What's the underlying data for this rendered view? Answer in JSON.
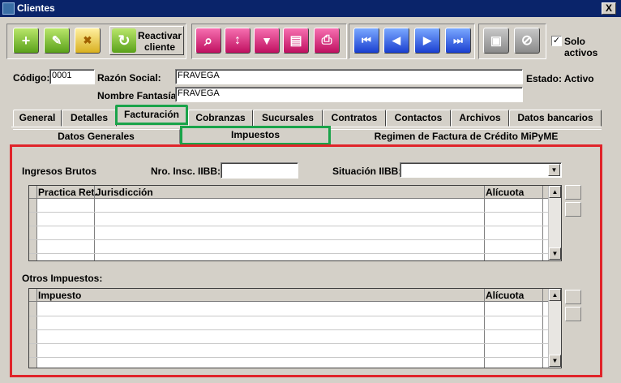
{
  "window": {
    "title": "Clientes",
    "close_label": "X"
  },
  "toolbar": {
    "reactivar_label": "Reactivar cliente",
    "solo_activos_label": "Solo activos",
    "solo_activos_checked": "✓",
    "icons": {
      "add": "+",
      "edit": "✎",
      "delete": "✖",
      "search": "⌕",
      "sort": "↕",
      "filter": "▼",
      "clipboard": "▤",
      "print": "⎙",
      "first": "⏮",
      "prev": "◀",
      "next": "▶",
      "last": "⏭",
      "save": "▣",
      "cancel": "⊘"
    }
  },
  "form": {
    "codigo_label": "Código:",
    "codigo_value": "0001",
    "razon_label": "Razón Social:",
    "razon_value": "FRAVEGA",
    "nombre_label": "Nombre Fantasía:",
    "nombre_value": "FRAVEGA",
    "estado": "Estado: Activo"
  },
  "tabs": [
    "General",
    "Detalles",
    "Facturación",
    "Cobranzas",
    "Sucursales",
    "Contratos",
    "Contactos",
    "Archivos",
    "Datos bancarios"
  ],
  "subtabs": [
    "Datos Generales",
    "Impuestos",
    "Regimen de Factura de Crédito MiPyME"
  ],
  "iibb": {
    "title": "Ingresos Brutos",
    "nro_label": "Nro. Insc. IIBB:",
    "nro_value": "",
    "situacion_label": "Situación IIBB:",
    "situacion_value": ""
  },
  "grid1": {
    "columns": [
      "Practica Ret.",
      "Jurisdicción",
      "Alícuota"
    ]
  },
  "otros": {
    "title": "Otros Impuestos:"
  },
  "grid2": {
    "columns": [
      "Impuesto",
      "Alícuota"
    ]
  }
}
